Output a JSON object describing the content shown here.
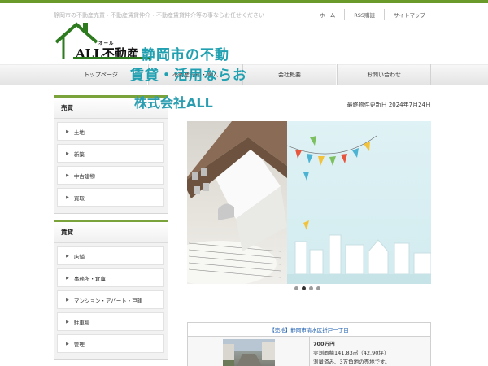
{
  "header": {
    "tagline": "静岡市の不動産売買・不動産賃貸仲介・不動産賃貸仲介等の事ならお任せください",
    "links": [
      "ホーム",
      "RSS購読",
      "サイトマップ"
    ],
    "logo_sub": "オール",
    "logo_main": "ALL不動産"
  },
  "nav": [
    "トップページ",
    "不動産売却・購入",
    "会社概要",
    "お問い合わせ"
  ],
  "sidebar": {
    "sections": [
      {
        "title": "売買",
        "items": [
          "土地",
          "新築",
          "中古建物",
          "買取"
        ]
      },
      {
        "title": "賃貸",
        "items": [
          "店舗",
          "事務所・倉庫",
          "マンション・アパート・戸建",
          "駐車場",
          "管理"
        ]
      }
    ]
  },
  "main": {
    "updated": "最終物件更新日 2024年7月24日",
    "banner": {
      "line1": "静岡市の不動",
      "line2": "賃貸・活用ならお",
      "line3": "株式会社ALL"
    },
    "carousel": {
      "count": 4,
      "active": 1
    },
    "listing": {
      "title": "【売地】静岡市清水区折戸一丁目",
      "price": "700万円",
      "area": "実測面積141.83㎡（42.90坪）",
      "note": "測量済み、3方角地の売地です。"
    }
  },
  "colors": {
    "accent": "#7aa43b",
    "brand_green": "#2d7a1f",
    "banner_text": "#20a0b0"
  },
  "icons": {
    "list_arrow": "triangle-right-icon"
  }
}
